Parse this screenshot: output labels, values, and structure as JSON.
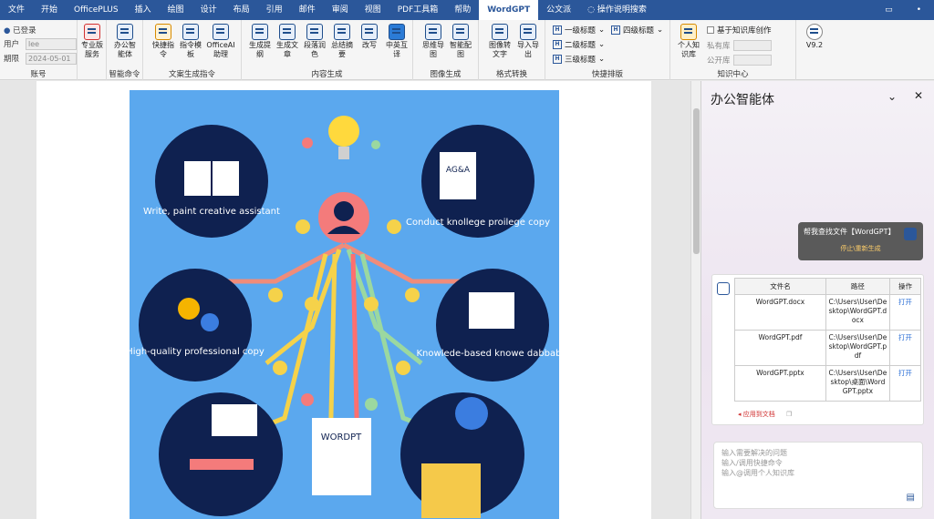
{
  "menubar": {
    "tabs": [
      "文件",
      "开始",
      "OfficePLUS",
      "插入",
      "绘图",
      "设计",
      "布局",
      "引用",
      "邮件",
      "审阅",
      "视图",
      "PDF工具箱",
      "帮助",
      "WordGPT",
      "公文派"
    ],
    "active": "WordGPT",
    "search": "操作说明搜索"
  },
  "ribbon": {
    "account": {
      "status": "已登录",
      "user_label": "用户",
      "user_value": "lee",
      "date_label": "期限",
      "date_value": "2024-05-01",
      "group_label": "账号"
    },
    "pro": {
      "label": "专业版服务"
    },
    "agent": {
      "label": "办公智能体",
      "group_label": "智能命令"
    },
    "copy_group": {
      "items": [
        "快捷指令",
        "指令模板",
        "OfficeAI助理"
      ],
      "group_label": "文案生成指令"
    },
    "content_group": {
      "items": [
        "生成提纲",
        "生成文章",
        "段落润色",
        "总结摘要",
        "改写",
        "中英互译"
      ],
      "group_label": "内容生成"
    },
    "image_group": {
      "items": [
        "思维导图",
        "智能配图"
      ],
      "group_label": "图像生成"
    },
    "format_group": {
      "items": [
        "图像转文字",
        "导入导出"
      ],
      "group_label": "格式转换"
    },
    "layout_group": {
      "h1": "一级标题",
      "h2": "二级标题",
      "h3": "三级标题",
      "h4": "四级标题",
      "group_label": "快捷排版"
    },
    "kb_group": {
      "personal": "个人知识库",
      "checkbox": "基于知识库创作",
      "private": "私有库",
      "public": "公开库",
      "group_label": "知识中心"
    },
    "version": "V9.2"
  },
  "picture": {
    "labels": [
      "Write, paint creative assistant",
      "Conduct knollege proilege copy",
      "High-quality professional copy",
      "Knowlede-based knowe dabbabis",
      "WORDPT",
      "AG&A"
    ]
  },
  "pane": {
    "title": "办公智能体",
    "bubble_text": "帮我查找文件【WordGPT】",
    "bubble_sub": "停止\\重新生成",
    "table": {
      "headers": [
        "文件名",
        "路径",
        "操作"
      ],
      "rows": [
        [
          "WordGPT.docx",
          "C:\\Users\\User\\Desktop\\WordGPT.docx",
          "打开"
        ],
        [
          "WordGPT.pdf",
          "C:\\Users\\User\\Desktop\\WordGPT.pdf",
          "打开"
        ],
        [
          "WordGPT.pptx",
          "C:\\Users\\User\\Desktop\\桌面\\WordGPT.pptx",
          "打开"
        ]
      ]
    },
    "apply": "应用到文档",
    "input_lines": [
      "输入需要解决的问题",
      "输入/调用快捷命令",
      "输入@调用个人知识库"
    ]
  }
}
